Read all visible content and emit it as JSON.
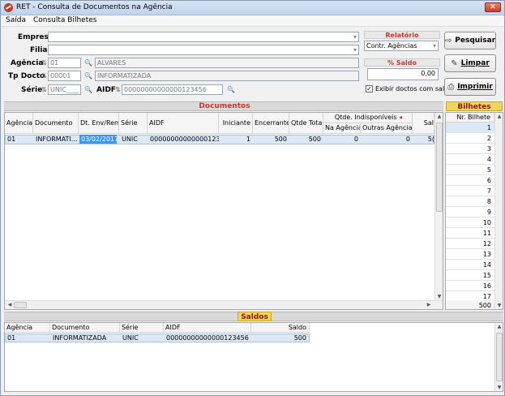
{
  "window": {
    "title": "RET - Consulta de Documentos na Agência",
    "close_label": "✕"
  },
  "menu": {
    "items": [
      "Saída",
      "Consulta Bilhetes"
    ]
  },
  "form": {
    "empresa_label": "Empresa",
    "filial_label": "Filial",
    "agencia_label": "Agência",
    "agencia_code": "01",
    "agencia_name": "ALVARES",
    "tpdocto_label": "Tp Docto",
    "tpdocto_code": "00001",
    "tpdocto_name": "INFORMATIZADA",
    "serie_label": "Série",
    "serie_value": "UNIC____",
    "aidf_label": "AIDF",
    "aidf_value": "00000000000000123456",
    "binoculars": "🔍"
  },
  "relatorio": {
    "title": "Relatório",
    "selected": "Contr. Agências"
  },
  "saldo": {
    "title": "% Saldo",
    "value": "0,00"
  },
  "exibir": {
    "label": "Exibir doctos com saldo",
    "checked": "✓"
  },
  "buttons": {
    "pesquisar": "Pesquisar",
    "pesquisar_icon": "⇨",
    "limpar": "Limpar",
    "limpar_icon": "✎",
    "imprimir": "Imprimir",
    "imprimir_icon": "⎙"
  },
  "documentos": {
    "title": "Documentos",
    "headers": [
      "Agência",
      "Documento",
      "Dt. Env/Rem",
      "Série",
      "AIDF",
      "Iniciante",
      "Encerrante",
      "Qtde Total",
      "Qtde. Indisponíveis",
      "Na Agência",
      "Outras Agências",
      "Sal"
    ],
    "sort_marker": "◂",
    "rows": [
      {
        "agencia": "01",
        "documento": "INFORMATI...",
        "dt": "03/02/2017",
        "serie": "UNIC",
        "aidf": "00000000000000123456",
        "iniciante": "1",
        "encerrante": "500",
        "qtde_total": "500",
        "na_agencia": "0",
        "outras": "0",
        "sal": "5("
      }
    ]
  },
  "bilhetes": {
    "title": "Bilhetes",
    "header": "Nr. Bilhete",
    "rows": [
      "1",
      "2",
      "3",
      "4",
      "5",
      "6",
      "7",
      "8",
      "9",
      "10",
      "11",
      "12",
      "13",
      "14",
      "15",
      "16",
      "17"
    ],
    "last": "500"
  },
  "saldos": {
    "title": "Saldos",
    "headers": [
      "Agência",
      "Documento",
      "Série",
      "AIDF",
      "Saldo"
    ],
    "rows": [
      {
        "agencia": "01",
        "documento": "INFORMATIZADA",
        "serie": "UNIC",
        "aidf": "00000000000000123456",
        "saldo": "500"
      }
    ]
  }
}
